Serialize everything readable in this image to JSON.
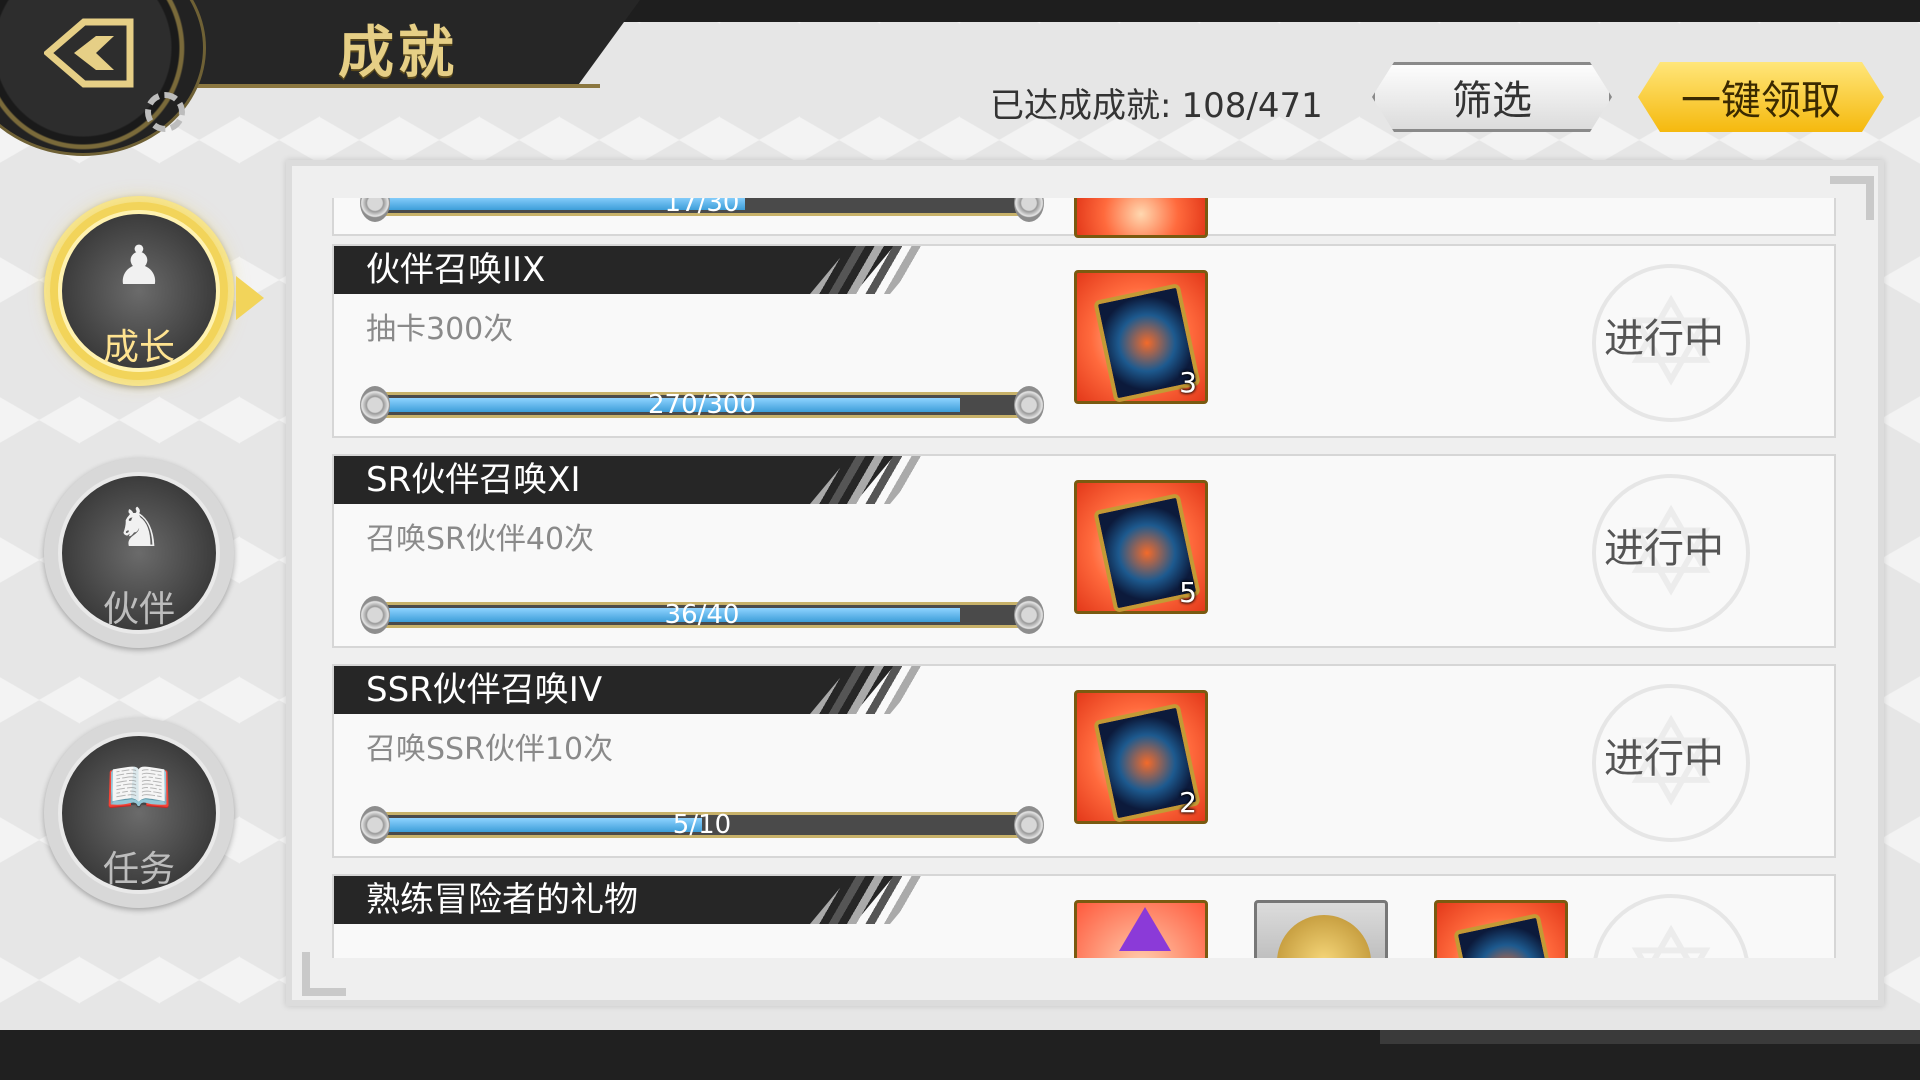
{
  "header": {
    "title": "成就",
    "achieved_label": "已达成成就:",
    "achieved_value": "108/471",
    "filter_label": "筛选",
    "claim_all_label": "一键领取"
  },
  "sidebar": {
    "items": [
      {
        "label": "成长",
        "icon": "hooded-figure-icon",
        "active": true
      },
      {
        "label": "伙伴",
        "icon": "party-icon",
        "active": false
      },
      {
        "label": "任务",
        "icon": "book-flame-icon",
        "active": false
      }
    ]
  },
  "achievements": [
    {
      "title": "",
      "desc": "",
      "progress_text": "17/30",
      "progress": 0.567,
      "reward_qty": "",
      "status": ""
    },
    {
      "title": "伙伴召唤IIX",
      "desc": "抽卡300次",
      "progress_text": "270/300",
      "progress": 0.9,
      "reward_qty": "3",
      "status": "进行中"
    },
    {
      "title": "SR伙伴召唤XI",
      "desc": "召唤SR伙伴40次",
      "progress_text": "36/40",
      "progress": 0.9,
      "reward_qty": "5",
      "status": "进行中"
    },
    {
      "title": "SSR伙伴召唤IV",
      "desc": "召唤SSR伙伴10次",
      "progress_text": "5/10",
      "progress": 0.5,
      "reward_qty": "2",
      "status": "进行中"
    },
    {
      "title": "熟练冒险者的礼物",
      "desc": "",
      "progress_text": "",
      "progress": 0,
      "reward_qty": "",
      "status": ""
    }
  ],
  "colors": {
    "accent_gold": "#f2d45a",
    "progress_blue": "#3d9ed9",
    "title_bar": "#262626"
  }
}
